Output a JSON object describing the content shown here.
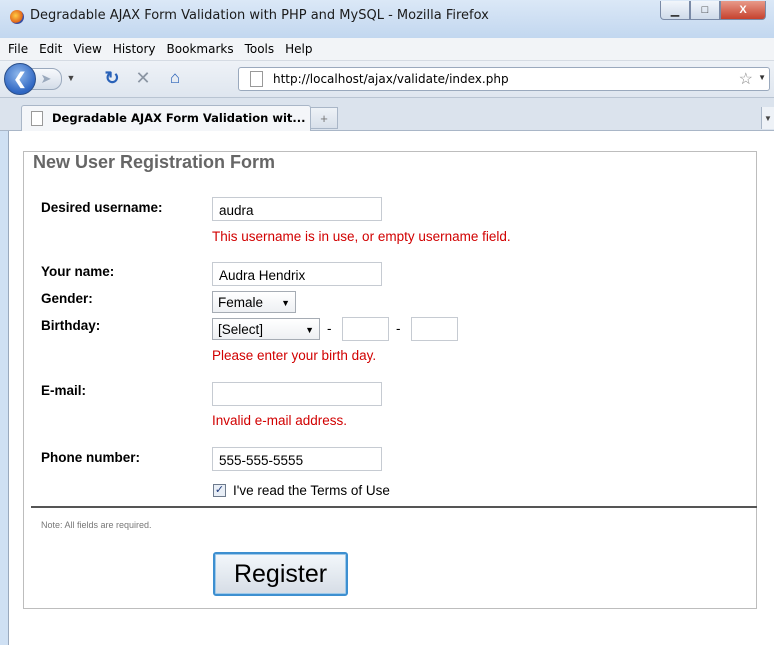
{
  "window": {
    "title": "Degradable AJAX Form Validation with PHP and MySQL - Mozilla Firefox",
    "minimize_label": "▁",
    "maximize_label": "□",
    "close_label": "X"
  },
  "menubar": {
    "items": [
      "File",
      "Edit",
      "View",
      "History",
      "Bookmarks",
      "Tools",
      "Help"
    ]
  },
  "navbar": {
    "url": "http://localhost/ajax/validate/index.php"
  },
  "tabs": {
    "active_title": "Degradable AJAX Form Validation wit...",
    "new_tab_label": "+"
  },
  "form": {
    "legend": "New User Registration Form",
    "username": {
      "label": "Desired username:",
      "value": "audra",
      "error": "This username is in use, or empty username field."
    },
    "name": {
      "label": "Your name:",
      "value": "Audra Hendrix"
    },
    "gender": {
      "label": "Gender:",
      "selected": "Female"
    },
    "birthday": {
      "label": "Birthday:",
      "month_selected": "[Select]",
      "day_value": "",
      "year_value": "",
      "separator": "-",
      "error": "Please enter your birth day."
    },
    "email": {
      "label": "E-mail:",
      "value": "",
      "error": "Invalid e-mail address."
    },
    "phone": {
      "label": "Phone number:",
      "value": "555-555-5555"
    },
    "terms": {
      "checked": true,
      "label": "I've read the Terms of Use"
    },
    "note": "Note: All fields are required.",
    "submit_label": "Register"
  }
}
